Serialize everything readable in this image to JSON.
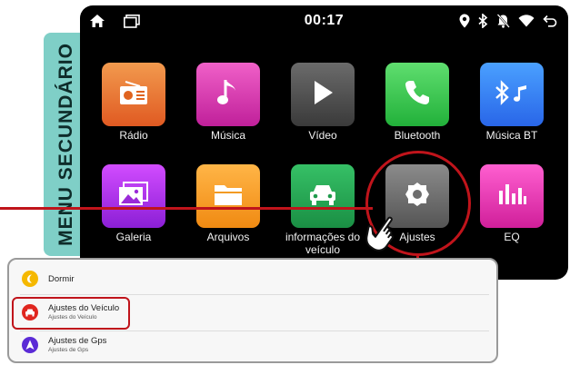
{
  "side_tab": {
    "label": "MENU SECUNDÁRIO"
  },
  "status_bar": {
    "time": "00:17",
    "icons": [
      "home-icon",
      "recent-apps-icon",
      "location-icon",
      "bluetooth-icon",
      "notifications-off-icon",
      "wifi-icon",
      "back-icon"
    ]
  },
  "apps": [
    {
      "label": "Rádio",
      "icon": "radio-icon"
    },
    {
      "label": "Música",
      "icon": "music-note-icon"
    },
    {
      "label": "Vídeo",
      "icon": "play-icon"
    },
    {
      "label": "Bluetooth",
      "icon": "phone-icon"
    },
    {
      "label": "Música BT",
      "icon": "bluetooth-music-icon"
    },
    {
      "label": "Galeria",
      "icon": "gallery-icon"
    },
    {
      "label": "Arquivos",
      "icon": "folder-icon"
    },
    {
      "label_line1": "informações do",
      "label_line2": "veículo",
      "icon": "car-icon"
    },
    {
      "label": "Ajustes",
      "icon": "gear-icon"
    },
    {
      "label": "EQ",
      "icon": "equalizer-icon"
    }
  ],
  "popup": {
    "items": [
      {
        "title": "Dormir",
        "icon": "moon-icon",
        "color": "#f5b800"
      },
      {
        "title": "Ajustes do Veículo",
        "subtitle": "Ajustes do Veículo",
        "icon": "car-icon",
        "color": "#e0261f"
      },
      {
        "title": "Ajustes de Gps",
        "subtitle": "Ajustes de Gps",
        "icon": "navigation-icon",
        "color": "#5b2bd6"
      }
    ]
  },
  "colors": {
    "callout_red": "#c0141b",
    "side_tab": "#7fcfc7",
    "screen_bg": "#000000"
  }
}
